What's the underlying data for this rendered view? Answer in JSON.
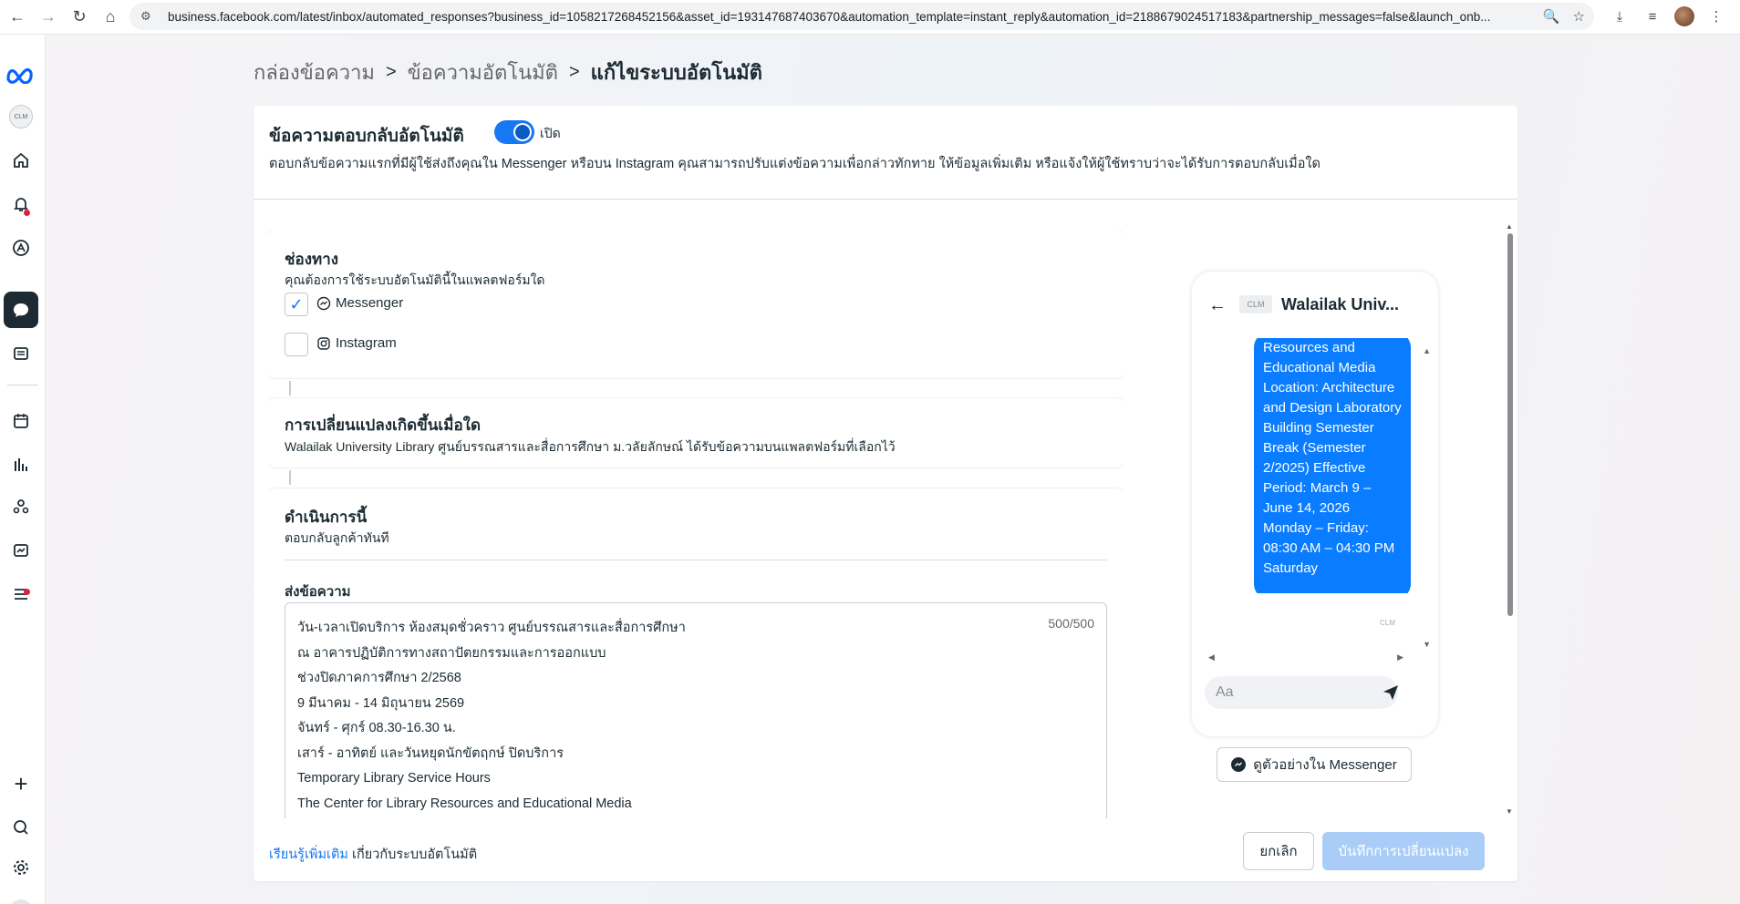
{
  "browser": {
    "url": "business.facebook.com/latest/inbox/automated_responses?business_id=1058217268452156&asset_id=193147687403670&automation_template=instant_reply&automation_id=2188679024517183&partnership_messages=false&launch_onb..."
  },
  "breadcrumb": {
    "items": [
      "กล่องข้อความ",
      "ข้อความอัตโนมัติ",
      "แก้ไขระบบอัตโนมัติ"
    ],
    "separator": ">"
  },
  "header": {
    "title": "ข้อความตอบกลับอัตโนมัติ",
    "toggle_label": "เปิด",
    "toggle_on": true,
    "description": "ตอบกลับข้อความแรกที่มีผู้ใช้ส่งถึงคุณใน Messenger หรือบน Instagram คุณสามารถปรับแต่งข้อความเพื่อกล่าวทักทาย ให้ข้อมูลเพิ่มเติม หรือแจ้งให้ผู้ใช้ทราบว่าจะได้รับการตอบกลับเมื่อใด"
  },
  "channels": {
    "title": "ช่องทาง",
    "subtitle": "คุณต้องการใช้ระบบอัตโนมัตินี้ในแพลตฟอร์มใด",
    "items": [
      {
        "label": "Messenger",
        "checked": true,
        "icon": "messenger-icon"
      },
      {
        "label": "Instagram",
        "checked": false,
        "icon": "instagram-icon"
      }
    ]
  },
  "trigger": {
    "title": "การเปลี่ยนแปลงเกิดขึ้นเมื่อใด",
    "subtitle": "Walailak University Library ศูนย์บรรณสารและสื่อการศึกษา ม.วลัยลักษณ์ ได้รับข้อความบนแพลตฟอร์มที่เลือกไว้"
  },
  "action": {
    "title": "ดำเนินการนี้",
    "subtitle": "ตอบกลับลูกค้าทันที",
    "message_label": "ส่งข้อความ",
    "char_count": "500/500",
    "message_lines": [
      "วัน-เวลาเปิดบริการ ห้องสมุดชั่วคราว ศูนย์บรรณสารและสื่อการศึกษา",
      "ณ อาคารปฏิบัติการทางสถาปัตยกรรมและการออกแบบ",
      "ช่วงปิดภาคการศึกษา 2/2568",
      "9 มีนาคม - 14 มิถุนายน 2569",
      "จันทร์ - ศุกร์ 08.30-16.30 น.",
      "เสาร์ - อาทิตย์ และวันหยุดนักขัตฤกษ์ ปิดบริการ",
      "Temporary Library Service Hours",
      "The Center for Library Resources and Educational Media"
    ]
  },
  "preview": {
    "page_name": "Walailak Univ...",
    "logo_text": "CLM",
    "bubble_text": "Resources and Educational Media Location: Architecture and Design Laboratory Building Semester Break (Semester 2/2025) Effective Period: March 9 – June 14, 2026 Monday – Friday: 08:30 AM – 04:30 PM Saturday",
    "input_placeholder": "Aa",
    "preview_button": "ดูตัวอย่างใน Messenger"
  },
  "footer": {
    "learn_link": "เรียนรู้เพิ่มเติม",
    "learn_rest": " เกี่ยวกับระบบอัตโนมัติ",
    "cancel": "ยกเลิก",
    "save": "บันทึกการเปลี่ยนแปลง"
  },
  "colors": {
    "accent": "#1877f2",
    "bubble": "#0a7cff",
    "save_disabled": "#a9cdf7"
  }
}
